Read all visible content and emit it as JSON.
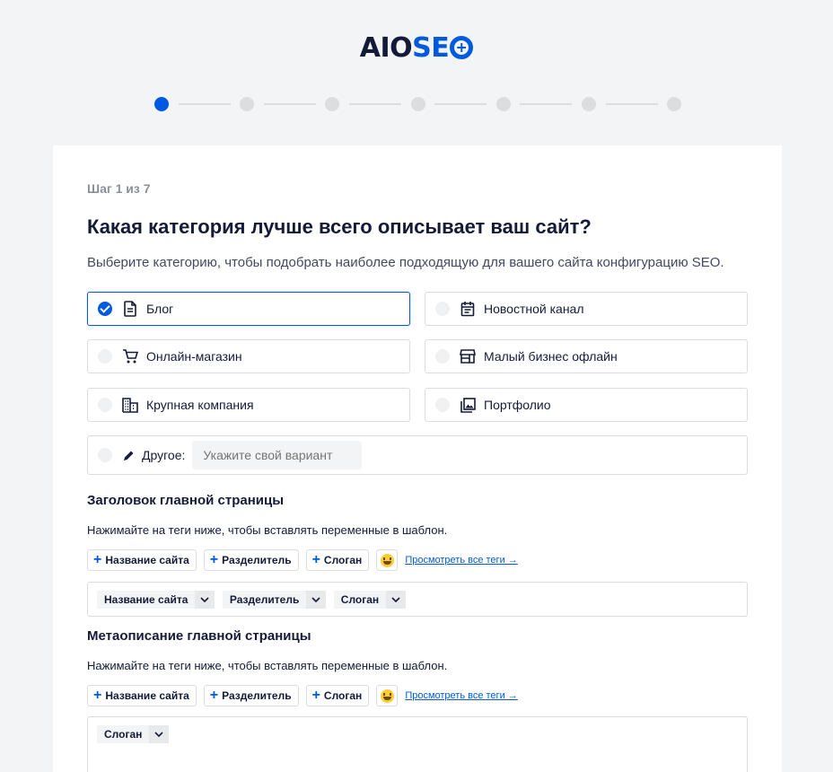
{
  "logo": {
    "part1": "AIO",
    "part2": "SE"
  },
  "wizard": {
    "current_step": 1,
    "total_steps": 7,
    "step_text": "Шаг 1 из 7"
  },
  "question": {
    "title": "Какая категория лучше всего описывает ваш сайт?",
    "description": "Выберите категорию, чтобы подобрать наиболее подходящую для вашего сайта конфигурацию SEO."
  },
  "categories": [
    {
      "label": "Блог",
      "icon": "document-icon",
      "selected": true
    },
    {
      "label": "Новостной канал",
      "icon": "calendar-icon",
      "selected": false
    },
    {
      "label": "Онлайн-магазин",
      "icon": "cart-icon",
      "selected": false
    },
    {
      "label": "Малый бизнес офлайн",
      "icon": "store-icon",
      "selected": false
    },
    {
      "label": "Крупная компания",
      "icon": "building-icon",
      "selected": false
    },
    {
      "label": "Портфолио",
      "icon": "gallery-icon",
      "selected": false
    }
  ],
  "other": {
    "label": "Другое:",
    "placeholder": "Укажите свой вариант",
    "value": ""
  },
  "title_section": {
    "heading": "Заголовок главной страницы",
    "hint": "Нажимайте на теги ниже, чтобы вставлять переменные в шаблон.",
    "tag_buttons": [
      "Название сайта",
      "Разделитель",
      "Слоган"
    ],
    "view_all": "Просмотреть все теги →",
    "editor_chips": [
      "Название сайта",
      "Разделитель",
      "Слоган"
    ]
  },
  "meta_section": {
    "heading": "Метаописание главной страницы",
    "hint": "Нажимайте на теги ниже, чтобы вставлять переменные в шаблон.",
    "tag_buttons": [
      "Название сайта",
      "Разделитель",
      "Слоган"
    ],
    "view_all": "Просмотреть все теги →",
    "editor_chips": [
      "Слоган"
    ]
  },
  "colors": {
    "accent": "#005ae0",
    "text": "#141b38",
    "muted": "#8c8f9a",
    "border": "#dcdde0",
    "background": "#f3f4f5"
  }
}
